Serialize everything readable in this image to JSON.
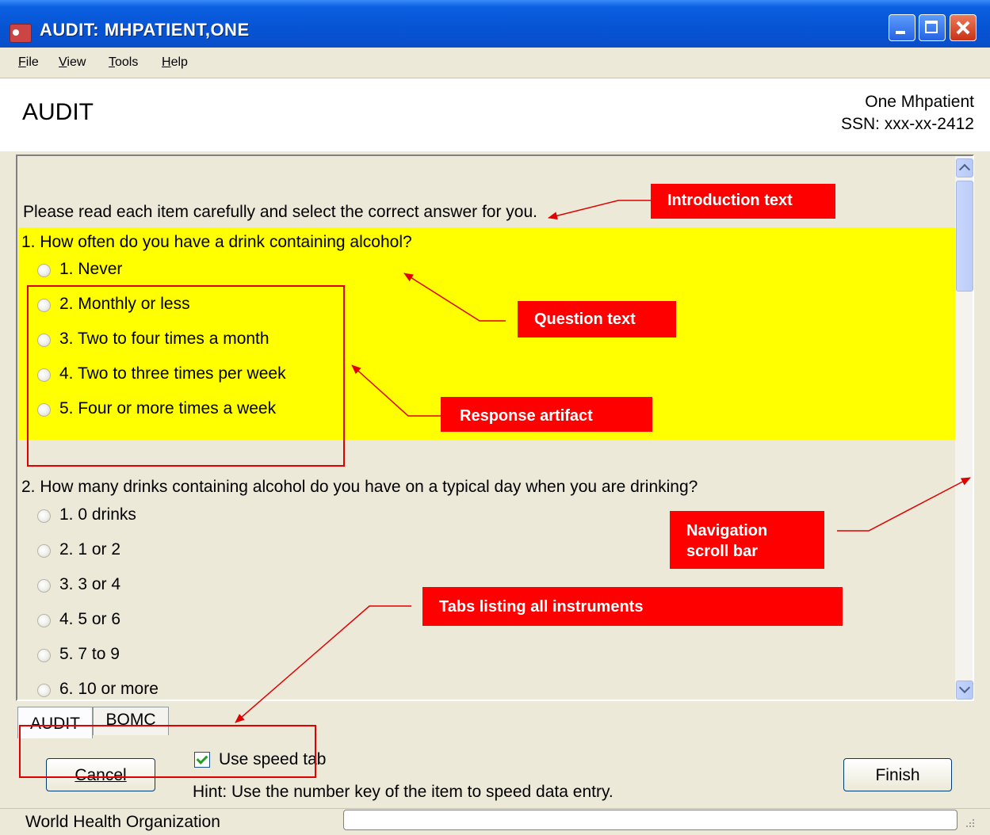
{
  "window": {
    "title": "AUDIT: MHPATIENT,ONE"
  },
  "menu": [
    {
      "label": "File",
      "key": "F",
      "rest": "ile"
    },
    {
      "label": "View",
      "key": "V",
      "rest": "iew"
    },
    {
      "label": "Tools",
      "key": "T",
      "rest": "ools"
    },
    {
      "label": "Help",
      "key": "H",
      "rest": "elp"
    }
  ],
  "header": {
    "title": "AUDIT",
    "patient_name": "One Mhpatient",
    "patient_ssn": "SSN: xxx-xx-2412"
  },
  "form": {
    "intro": "Please read each item carefully and select the correct answer for you.",
    "questions": [
      {
        "text": "1. How often do you have a drink containing alcohol?",
        "options": [
          "1. Never",
          "2. Monthly or less",
          "3. Two to four times a month",
          "4. Two to three times per week",
          "5. Four or more times a week"
        ]
      },
      {
        "text": "2. How many drinks containing alcohol do you have on a typical day when you are drinking?",
        "options": [
          "1. 0 drinks",
          "2. 1 or 2",
          "3. 3 or 4",
          "4. 5 or 6",
          "5. 7 to 9",
          "6. 10 or more"
        ]
      }
    ]
  },
  "tabs": [
    {
      "label": "AUDIT",
      "active": true
    },
    {
      "label": "BOMC",
      "active": false
    }
  ],
  "footer": {
    "cancel_label": "Cancel",
    "finish_label": "Finish",
    "speed_tab_label": "Use speed tab",
    "speed_tab_checked": true,
    "hint": "Hint: Use the number key of the item to speed data entry.",
    "status": "World Health Organization"
  },
  "annotations": {
    "intro": "Introduction text",
    "question": "Question text",
    "response": "Response artifact",
    "navigation_line1": "Navigation",
    "navigation_line2": "scroll bar",
    "tabs": "Tabs listing all instruments"
  },
  "colors": {
    "highlight": "#ffff00",
    "callout": "#ff0000",
    "titlebar": "#0654d4"
  }
}
